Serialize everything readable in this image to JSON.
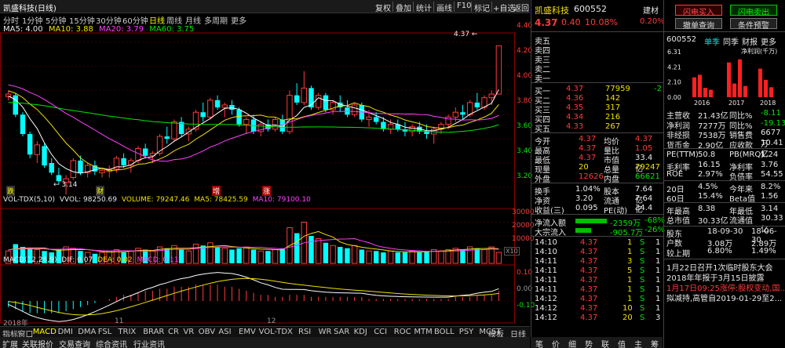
{
  "window": {
    "title": "凯盛科技(日线)"
  },
  "toolbar": {
    "items": [
      "复权",
      "叠加",
      "统计",
      "画线",
      "F10",
      "标记",
      "+自选",
      "返回"
    ]
  },
  "periods": [
    "分时",
    "1分钟",
    "5分钟",
    "15分钟",
    "30分钟",
    "60分钟",
    "日线",
    "周线",
    "月线",
    "多周期",
    "更多"
  ],
  "active_period": "日线",
  "ma": {
    "ma5": "MA5: 4.00",
    "ma10": "MA10: 3.88",
    "ma20": "MA20: 3.79",
    "ma60": "MA60: 3.75"
  },
  "price_axis": [
    "4.40",
    "4.20",
    "4.00",
    "3.80",
    "3.60",
    "3.40",
    "3.20"
  ],
  "price_labels": {
    "high": "4.37",
    "low": "3.14"
  },
  "event_marks": [
    "跌",
    "财",
    "增",
    "涨"
  ],
  "volume": {
    "header": "VOL-TDX(5,10)",
    "vvol": "VVOL: 98250.69",
    "volume": "VOLUME: 79247.46",
    "ma5": "MA5: 78425.59",
    "ma10": "MA10: 79100.10",
    "axis": [
      "30000",
      "20000",
      "10000"
    ],
    "unit": "X10"
  },
  "macd": {
    "header": "MACD(12,26,9)",
    "dif": "DIF: 0.07",
    "dea": "DEA: 0.02",
    "macd": "MACD: 0.11",
    "axis": [
      "0.10",
      "0.00",
      "-0.10"
    ]
  },
  "date_axis": [
    "2018年",
    "11",
    "12"
  ],
  "bottom_tabs": [
    "指标",
    "窗口",
    "MACD",
    "DMI",
    "DMA",
    "FSL",
    "TRIX",
    "BRAR",
    "CR",
    "VR",
    "OBV",
    "ASI",
    "EMV",
    "VOL-TDX",
    "RSI",
    "WR",
    "SAR",
    "KDJ",
    "CCI",
    "ROC",
    "MTM",
    "BOLL",
    "PSY",
    "MCST",
    "模板",
    "日线"
  ],
  "active_tab": "MACD",
  "bottom_tabs2": [
    "扩展",
    "关联报价",
    "交易查询",
    "综合资讯",
    "行业资讯"
  ],
  "quote": {
    "name": "凯盛科技",
    "code": "600552",
    "sector": "建材",
    "price": "4.37",
    "change": "0.40",
    "pct": "10.08%",
    "sector_pct": "0.20%",
    "sells": [
      {
        "label": "卖五",
        "price": "",
        "vol": ""
      },
      {
        "label": "卖四",
        "price": "",
        "vol": ""
      },
      {
        "label": "卖三",
        "price": "",
        "vol": ""
      },
      {
        "label": "卖二",
        "price": "",
        "vol": ""
      },
      {
        "label": "卖一",
        "price": "",
        "vol": ""
      }
    ],
    "buys": [
      {
        "label": "买一",
        "price": "4.37",
        "vol": "77959",
        "delta": "-2"
      },
      {
        "label": "买二",
        "price": "4.36",
        "vol": "142",
        "delta": ""
      },
      {
        "label": "买三",
        "price": "4.35",
        "vol": "317",
        "delta": ""
      },
      {
        "label": "买四",
        "price": "4.34",
        "vol": "216",
        "delta": ""
      },
      {
        "label": "买五",
        "price": "4.33",
        "vol": "267",
        "delta": ""
      }
    ],
    "stats": [
      {
        "l1": "今开",
        "v1": "4.37",
        "l2": "均价",
        "v2": "4.37"
      },
      {
        "l1": "最高",
        "v1": "4.37",
        "l2": "量比",
        "v2": "1.05"
      },
      {
        "l1": "最低",
        "v1": "4.37",
        "l2": "市值",
        "v2": "33.4亿"
      },
      {
        "l1": "现量",
        "v1": "20",
        "l2": "总量",
        "v2": "79247"
      },
      {
        "l1": "外盘",
        "v1": "12626",
        "l2": "内盘",
        "v2": "66621"
      }
    ],
    "stats2": [
      {
        "l1": "换手",
        "v1": "1.04%",
        "l2": "股本",
        "v2": "7.64亿"
      },
      {
        "l1": "净资",
        "v1": "3.20",
        "l2": "流通",
        "v2": "7.64亿"
      },
      {
        "l1": "收益(三)",
        "v1": "0.095",
        "l2": "PE(动)",
        "v2": "34.4"
      }
    ],
    "flow": [
      {
        "label": "净流入额",
        "val": "-2359万",
        "pct": "-68%"
      },
      {
        "label": "大宗流入",
        "val": "-905.7万",
        "pct": "-26%"
      }
    ],
    "ticks": [
      {
        "t": "14:10",
        "p": "4.37",
        "v": "1",
        "d": "S",
        "n": "1"
      },
      {
        "t": "14:10",
        "p": "4.37",
        "v": "1",
        "d": "S",
        "n": "1"
      },
      {
        "t": "14:11",
        "p": "4.37",
        "v": "3",
        "d": "S",
        "n": "1"
      },
      {
        "t": "14:11",
        "p": "4.37",
        "v": "5",
        "d": "S",
        "n": "1"
      },
      {
        "t": "14:11",
        "p": "4.37",
        "v": "1",
        "d": "S",
        "n": "1"
      },
      {
        "t": "14:11",
        "p": "4.37",
        "v": "1",
        "d": "S",
        "n": "1"
      },
      {
        "t": "14:12",
        "p": "4.37",
        "v": "1",
        "d": "S",
        "n": "1"
      },
      {
        "t": "14:12",
        "p": "4.37",
        "v": "10",
        "d": "S",
        "n": "1"
      },
      {
        "t": "14:12",
        "p": "4.37",
        "v": "20",
        "d": "S",
        "n": "3"
      }
    ],
    "bottom_tabs": [
      "笔",
      "价",
      "细",
      "势",
      "联",
      "值",
      "主",
      "筹"
    ]
  },
  "fin": {
    "buttons": {
      "flash_buy": "闪电买入",
      "flash_sell": "闪电卖出",
      "cancel": "撤单查询",
      "condition": "条件预警"
    },
    "code": "600552",
    "tabs": [
      "单季",
      "同季",
      "财报",
      "更多"
    ],
    "chart_title": "净利润(千万)",
    "chart_axis": [
      "6.31",
      "4.21",
      "2.10",
      "0.00"
    ],
    "chart_years": [
      "2016",
      "2017",
      "2018"
    ],
    "rows": [
      {
        "l1": "主营收",
        "v1": "21.43亿",
        "l2": "同比%",
        "v2": "-8.11"
      },
      {
        "l1": "净利润",
        "v1": "7277万",
        "l2": "同比%",
        "v2": "-19.13"
      },
      {
        "l1": "非经损",
        "v1": "7538万",
        "l2": "销售费",
        "v2": "6677万"
      },
      {
        "l1": "货币金",
        "v1": "2.90亿",
        "l2": "应收款",
        "v2": "10.41亿"
      },
      {
        "l1": "PE(TTM)",
        "v1": "50.8",
        "l2": "PB(MRQ)",
        "v2": "1.24"
      },
      {
        "l1": "毛利率",
        "v1": "16.15",
        "l2": "净利率",
        "v2": "3.76"
      },
      {
        "l1": "ROE",
        "v1": "2.97%",
        "l2": "负债率",
        "v2": "54.55"
      },
      {
        "l1": "20日",
        "v1": "4.5%",
        "l2": "今年来",
        "v2": "8.2%"
      },
      {
        "l1": "60日",
        "v1": "15.4%",
        "l2": "Beta值",
        "v2": "1.56"
      },
      {
        "l1": "年最高",
        "v1": "8.38",
        "l2": "年最低",
        "v2": "3.14"
      },
      {
        "l1": "总市值",
        "v1": "30.33亿",
        "l2": "流通值",
        "v2": "30.33亿"
      }
    ],
    "holders": [
      {
        "l1": "股东",
        "v1": "18-09-30",
        "v2": "18-06-30"
      },
      {
        "l1": "户数",
        "v1": "3.08万",
        "v2": "2.89万"
      },
      {
        "l1": "较上期",
        "v1": "6.80%",
        "v2": "1.49%"
      }
    ],
    "news": [
      "1月22日召开1次临时股东大会",
      "2018年年报于3月15日披露",
      "1月17日09:25涨停:股权变动,国...",
      "拟减持,高管自2019-01-29至2..."
    ]
  },
  "chart_data": {
    "type": "candlestick",
    "ylim": [
      3.05,
      4.45
    ],
    "candles": [
      [
        3.95,
        4.0,
        3.92,
        3.97
      ],
      [
        3.96,
        3.98,
        3.78,
        3.8
      ],
      [
        3.8,
        3.82,
        3.62,
        3.64
      ],
      [
        3.64,
        3.66,
        3.44,
        3.47
      ],
      [
        3.47,
        3.58,
        3.4,
        3.55
      ],
      [
        3.54,
        3.56,
        3.36,
        3.38
      ],
      [
        3.4,
        3.44,
        3.3,
        3.32
      ],
      [
        3.3,
        3.36,
        3.22,
        3.25
      ],
      [
        3.24,
        3.3,
        3.14,
        3.27
      ],
      [
        3.28,
        3.44,
        3.26,
        3.42
      ],
      [
        3.42,
        3.46,
        3.3,
        3.32
      ],
      [
        3.32,
        3.4,
        3.28,
        3.38
      ],
      [
        3.38,
        3.42,
        3.3,
        3.33
      ],
      [
        3.32,
        3.36,
        3.28,
        3.34
      ],
      [
        3.33,
        3.38,
        3.28,
        3.35
      ],
      [
        3.35,
        3.46,
        3.32,
        3.44
      ],
      [
        3.44,
        3.48,
        3.36,
        3.38
      ],
      [
        3.38,
        3.44,
        3.32,
        3.42
      ],
      [
        3.42,
        3.54,
        3.4,
        3.52
      ],
      [
        3.52,
        3.56,
        3.44,
        3.46
      ],
      [
        3.46,
        3.5,
        3.4,
        3.48
      ],
      [
        3.48,
        3.64,
        3.46,
        3.62
      ],
      [
        3.62,
        3.7,
        3.56,
        3.6
      ],
      [
        3.6,
        3.76,
        3.58,
        3.74
      ],
      [
        3.74,
        3.78,
        3.62,
        3.64
      ],
      [
        3.64,
        3.7,
        3.58,
        3.68
      ],
      [
        3.68,
        3.84,
        3.66,
        3.82
      ],
      [
        3.82,
        3.9,
        3.74,
        3.78
      ],
      [
        3.78,
        3.94,
        3.76,
        3.92
      ],
      [
        3.92,
        3.96,
        3.84,
        3.86
      ],
      [
        3.86,
        3.9,
        3.78,
        3.88
      ],
      [
        3.88,
        3.92,
        3.8,
        3.84
      ],
      [
        3.84,
        3.86,
        3.7,
        3.72
      ],
      [
        3.72,
        3.78,
        3.64,
        3.76
      ],
      [
        3.76,
        3.8,
        3.64,
        3.66
      ],
      [
        3.66,
        3.74,
        3.62,
        3.72
      ],
      [
        3.72,
        3.76,
        3.66,
        3.68
      ],
      [
        3.68,
        3.78,
        3.66,
        3.76
      ],
      [
        3.76,
        3.8,
        3.64,
        3.66
      ],
      [
        3.66,
        4.0,
        3.64,
        3.96
      ],
      [
        3.96,
        4.06,
        3.88,
        3.9
      ],
      [
        3.9,
        4.16,
        3.88,
        4.02
      ],
      [
        4.02,
        4.04,
        3.84,
        3.86
      ],
      [
        3.86,
        3.98,
        3.84,
        3.96
      ],
      [
        3.96,
        3.98,
        3.82,
        3.84
      ],
      [
        3.84,
        3.92,
        3.8,
        3.9
      ],
      [
        3.9,
        3.96,
        3.82,
        3.86
      ],
      [
        3.86,
        3.92,
        3.78,
        3.8
      ],
      [
        3.8,
        3.9,
        3.78,
        3.88
      ],
      [
        3.88,
        3.9,
        3.74,
        3.76
      ],
      [
        3.76,
        3.84,
        3.7,
        3.78
      ],
      [
        3.78,
        3.82,
        3.72,
        3.74
      ],
      [
        3.74,
        3.78,
        3.66,
        3.68
      ],
      [
        3.68,
        3.76,
        3.64,
        3.72
      ],
      [
        3.72,
        3.76,
        3.66,
        3.68
      ],
      [
        3.68,
        3.74,
        3.62,
        3.66
      ],
      [
        3.66,
        3.72,
        3.62,
        3.7
      ],
      [
        3.7,
        3.74,
        3.64,
        3.66
      ],
      [
        3.66,
        3.72,
        3.6,
        3.64
      ],
      [
        3.64,
        3.7,
        3.56,
        3.68
      ],
      [
        3.68,
        3.74,
        3.64,
        3.72
      ],
      [
        3.72,
        3.8,
        3.68,
        3.78
      ],
      [
        3.78,
        3.86,
        3.74,
        3.82
      ],
      [
        3.82,
        3.88,
        3.76,
        3.8
      ],
      [
        3.8,
        3.92,
        3.78,
        3.9
      ],
      [
        3.9,
        3.98,
        3.84,
        3.86
      ],
      [
        3.86,
        3.96,
        3.84,
        3.94
      ],
      [
        3.94,
        4.0,
        3.88,
        3.97
      ],
      [
        3.97,
        4.37,
        3.97,
        4.37
      ]
    ],
    "volumes": [
      9,
      14,
      12,
      11,
      10,
      9,
      8,
      10,
      12,
      11,
      9,
      8,
      7,
      8,
      9,
      10,
      8,
      9,
      11,
      10,
      9,
      12,
      11,
      13,
      10,
      9,
      14,
      13,
      15,
      12,
      11,
      10,
      11,
      12,
      10,
      9,
      9,
      10,
      11,
      26,
      22,
      30,
      20,
      18,
      15,
      13,
      12,
      11,
      13,
      10,
      9,
      9,
      8,
      9,
      8,
      8,
      9,
      8,
      9,
      10,
      9,
      10,
      11,
      10,
      12,
      11,
      10,
      12,
      8
    ],
    "macd_hist": [
      -3,
      -4,
      -5,
      -6,
      -6,
      -6,
      -6,
      -6,
      -5,
      -4,
      -3,
      -2,
      -1,
      0,
      1,
      2,
      3,
      3,
      4,
      5,
      5,
      6,
      6,
      7,
      7,
      7,
      8,
      8,
      8,
      8,
      7,
      7,
      6,
      5,
      4,
      3,
      3,
      2,
      2,
      3,
      3,
      3,
      2,
      2,
      2,
      2,
      2,
      2,
      2,
      2,
      1,
      1,
      1,
      1,
      1,
      1,
      1,
      1,
      1,
      1,
      1,
      1,
      2,
      2,
      2,
      3,
      3,
      3,
      5
    ]
  }
}
